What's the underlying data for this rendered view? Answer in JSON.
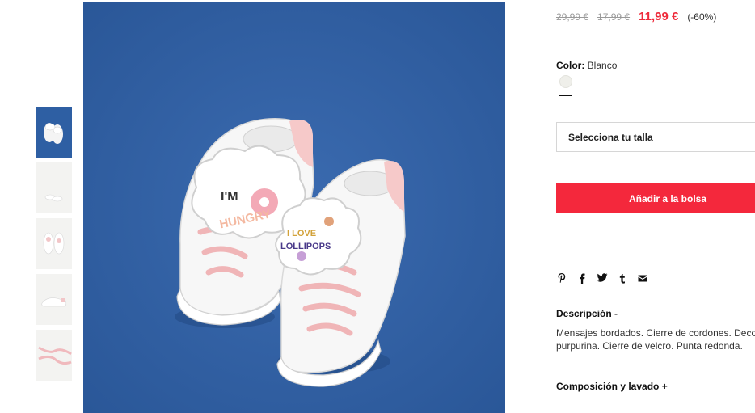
{
  "gallery": {
    "thumbnails": [
      {
        "label": "product-photo-1",
        "selected": true
      },
      {
        "label": "product-photo-2",
        "selected": false
      },
      {
        "label": "product-photo-3",
        "selected": false
      },
      {
        "label": "product-photo-4",
        "selected": false
      },
      {
        "label": "product-photo-5",
        "selected": false
      }
    ],
    "main_image": {
      "patch_left_line1": "I'M",
      "patch_left_line2": "HUNGRY",
      "patch_right_line1": "I LOVE",
      "patch_right_line2": "LOLLIPOPS"
    }
  },
  "product": {
    "price_original": "29,99 €",
    "price_previous": "17,99 €",
    "price_current": "11,99 €",
    "discount": "(-60%)",
    "color_label": "Color:",
    "color_value": "Blanco",
    "size_select_label": "Selecciona tu talla",
    "add_to_bag_label": "Añadir a la bolsa",
    "description_title": "Descripción  -",
    "description_lines": [
      "Mensajes bordados. Cierre de cordones. Decor",
      "purpurina. Cierre de velcro. Punta redonda."
    ],
    "composition_title": "Composición y lavado  +"
  },
  "share": {
    "icons": [
      "pinterest-icon",
      "facebook-icon",
      "twitter-icon",
      "tumblr-icon",
      "email-icon"
    ],
    "glyphs": [
      "P",
      "f",
      "t",
      "t",
      "✉"
    ]
  },
  "colors": {
    "accent": "#f4283c",
    "price_sale": "#ee2a3a",
    "image_background": "#2e5fa3"
  }
}
